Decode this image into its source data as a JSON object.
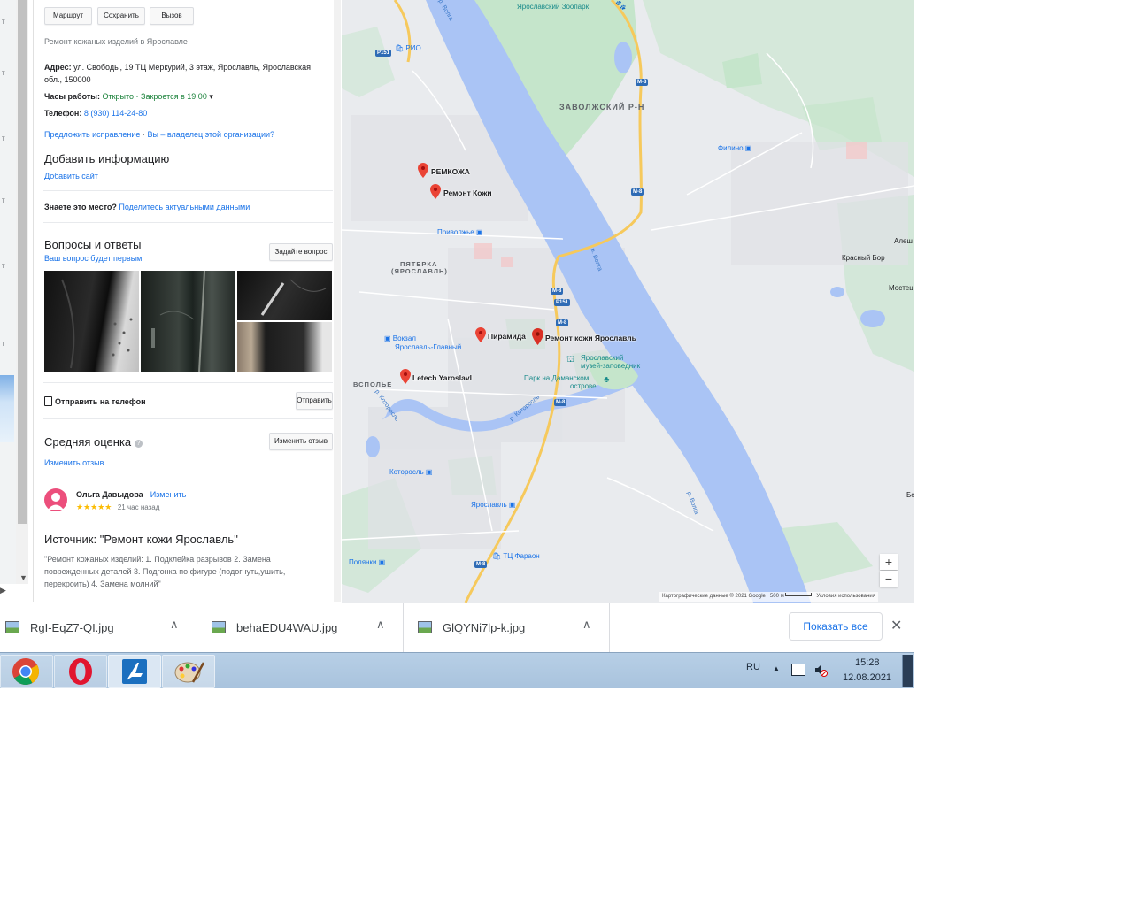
{
  "panel": {
    "buttons": {
      "route": "Маршрут",
      "save": "Сохранить",
      "call": "Вызов"
    },
    "category": "Ремонт кожаных изделий в Ярославле",
    "address_label": "Адрес:",
    "address_value": "ул. Свободы, 19 ТЦ Меркурий, 3 этаж, Ярославль, Ярославская",
    "address_value2": "обл., 150000",
    "hours_label": "Часы работы:",
    "hours_value": "Открыто · Закроется в 19:00",
    "phone_label": "Телефон:",
    "phone_value": "8 (930) 114-24-80",
    "suggest_edit": "Предложить исправление",
    "owner_link": "Вы – владелец этой организации?",
    "add_info_title": "Добавить информацию",
    "add_site": "Добавить сайт",
    "know_place_label": "Знаете это место?",
    "know_place_link": "Поделитесь актуальными данными",
    "qa_title": "Вопросы и ответы",
    "qa_sub": "Ваш вопрос будет первым",
    "ask_button": "Задайте вопрос",
    "send_phone": "Отправить на телефон",
    "send_button": "Отправить",
    "avg_rating": "Средняя оценка",
    "edit_review_button": "Изменить отзыв",
    "edit_review_link": "Изменить отзыв",
    "reviewer_name": "Ольга Давыдова",
    "reviewer_sep": "·",
    "reviewer_edit": "Изменить",
    "review_stars": "★★★★★",
    "review_time": "21 час назад",
    "source_title": "Источник: \"Ремонт кожи Ярославль\"",
    "source_text1": "\"Ремонт кожаных изделий: 1. Подклейка разрывов 2. Замена",
    "source_text2": "поврежденных деталей 3. Подгонка по фигуре (подогнуть,ушить,",
    "source_text3": "перекроить) 4. Замена молний\""
  },
  "map": {
    "districts": {
      "zavolzh": "ЗАВОЛЖСКИЙ Р-Н",
      "pyaterka": "ПЯТЕРКА",
      "pyaterka2": "(ЯРОСЛАВЛЬ)",
      "vspolye": "ВСПОЛЬЕ"
    },
    "places": {
      "zoo": "Ярославский Зоопарк",
      "rio": "РИО",
      "filino": "Филино",
      "privolzhe": "Приволжье",
      "vokzal1": "Вокзал",
      "vokzal2": "Ярославль-Главный",
      "museum1": "Ярославский",
      "museum2": "музей-заповедник",
      "park1": "Парк на Даманском",
      "park2": "острове",
      "kotorosl": "Которосль",
      "yaroslavl": "Ярославль",
      "pharaon": "ТЦ Фараон",
      "polyanki": "Полянки",
      "aleshki": "Алеш",
      "krasny_bor": "Красный Бор",
      "mostec": "Мостец",
      "be": "Бе"
    },
    "rivers": {
      "volga1": "р. Волга",
      "volga2": "р. Волга",
      "volga3": "р. Волга",
      "kotorosl": "р. Которосль",
      "kotorosl2": "р. Которосль"
    },
    "shields": {
      "p151a": "P151",
      "p151b": "P151",
      "m8a": "M-8",
      "m8b": "M-8",
      "m8c": "M-8",
      "m8d": "M-8",
      "m8e": "M-8",
      "m8f": "M-8"
    },
    "pins": {
      "remkozha": "РЕМКОЖА",
      "remont_kozhi": "Ремонт Кожи",
      "piramida": "Пирамида",
      "remont_kozhi_yar": "Ремонт кожи Ярославль",
      "letech": "Letech Yaroslavl"
    },
    "zoom_in": "+",
    "zoom_out": "−",
    "attribution": "Картографические данные © 2021 Google",
    "scale": "500 м",
    "terms": "Условия использования"
  },
  "downloads": {
    "items": [
      {
        "name": "RgI-EqZ7-QI.jpg"
      },
      {
        "name": "behaEDU4WAU.jpg"
      },
      {
        "name": "GlQYNi7lp-k.jpg"
      }
    ],
    "show_all": "Показать все",
    "close": "✕",
    "chevron": "∧"
  },
  "taskbar": {
    "lang": "RU",
    "time": "15:28",
    "date": "12.08.2021",
    "tray_arrow": "▲"
  },
  "colors": {
    "accent": "#1a73e8",
    "pin": "#ea4335",
    "water": "#aac4f5",
    "park": "#c0e4c8",
    "road": "#fbd47a"
  }
}
